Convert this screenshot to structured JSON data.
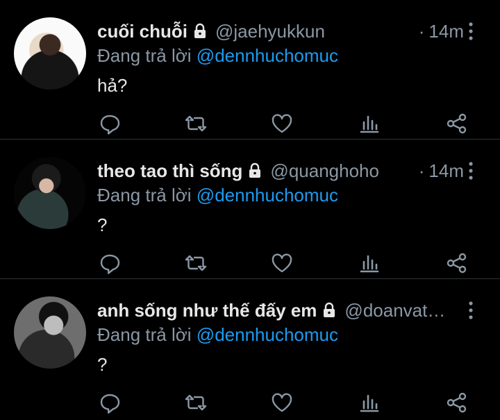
{
  "tweets": [
    {
      "name": "cuối chuỗi",
      "handle": "@jaehyukkun",
      "sep": "·",
      "time": "14m",
      "replying_prefix": "Đang trả lời",
      "replying_to": "@dennhuchomuc",
      "text": "hả?"
    },
    {
      "name": "theo tao thì sống",
      "handle": "@quanghoho",
      "sep": "·",
      "time": "14m",
      "replying_prefix": "Đang trả lời",
      "replying_to": "@dennhuchomuc",
      "text": "?"
    },
    {
      "name": "anh sống như thế đấy em",
      "handle": "@doanvat…",
      "sep": "",
      "time": "",
      "replying_prefix": "Đang trả lời",
      "replying_to": "@dennhuchomuc",
      "text": "?"
    }
  ],
  "icons": [
    "lock-icon",
    "more-icon",
    "reply-icon",
    "retweet-icon",
    "like-icon",
    "analytics-icon",
    "share-icon"
  ],
  "colors": {
    "background": "#000000",
    "text": "#e7e7e7",
    "muted": "#8b98a5",
    "accent": "#1d9bf0",
    "divider": "#2f3336"
  }
}
